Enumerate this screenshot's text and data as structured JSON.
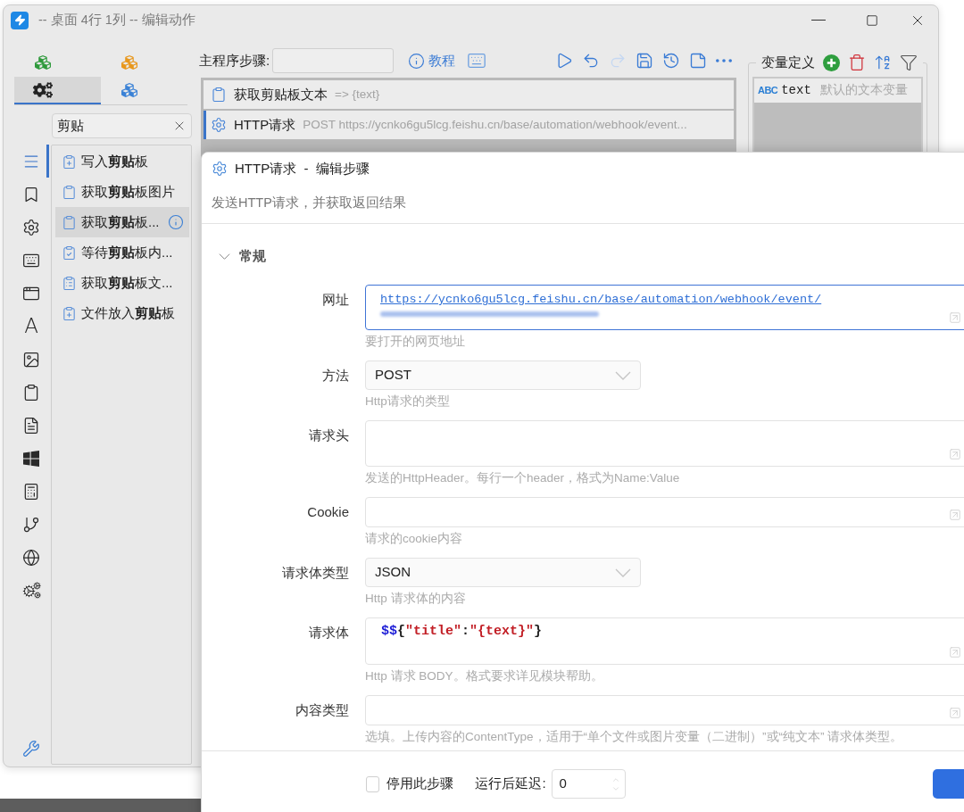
{
  "window": {
    "title": "-- 桌面 4行 1列 -- 编辑动作"
  },
  "palette_tabs": [
    {
      "kind": "cubes",
      "color": "#2f9a3c",
      "selected": false
    },
    {
      "kind": "cubes",
      "color": "#e8971c",
      "selected": false
    },
    {
      "kind": "gears",
      "selected": true
    },
    {
      "kind": "cubes",
      "color": "#3b82d6",
      "selected": false
    }
  ],
  "search": {
    "value": "剪贴"
  },
  "categories": [
    {
      "kind": "list",
      "selected": true
    },
    {
      "kind": "bookmark",
      "selected": false
    },
    {
      "kind": "gear",
      "selected": false
    },
    {
      "kind": "keyboard",
      "selected": false
    },
    {
      "kind": "window",
      "selected": false
    },
    {
      "kind": "glyph",
      "glyph": "A",
      "selected": false
    },
    {
      "kind": "image",
      "selected": false
    },
    {
      "kind": "clipboard",
      "selected": false
    },
    {
      "kind": "document",
      "selected": false
    },
    {
      "kind": "windows",
      "selected": false
    },
    {
      "kind": "calculator",
      "selected": false
    },
    {
      "kind": "branch",
      "selected": false
    },
    {
      "kind": "globe",
      "selected": false
    },
    {
      "kind": "gears",
      "selected": false
    }
  ],
  "actions": [
    {
      "kind": "plus",
      "label": "写入**剪贴**板",
      "selected": false
    },
    {
      "kind": "plain",
      "label": "获取**剪贴**板图片",
      "selected": false
    },
    {
      "kind": "plain",
      "label": "获取**剪贴**板...",
      "selected": true
    },
    {
      "kind": "check",
      "label": "等待**剪贴**板内...",
      "selected": false
    },
    {
      "kind": "list",
      "label": "获取**剪贴**板文...",
      "selected": false
    },
    {
      "kind": "plus",
      "label": "文件放入**剪贴**板",
      "selected": false
    }
  ],
  "main_steps": {
    "label": "主程序步骤:",
    "tutorial": "教程"
  },
  "toolbar": [
    {
      "kind": "play",
      "disabled": false
    },
    {
      "kind": "undo",
      "disabled": false
    },
    {
      "kind": "redo",
      "disabled": true
    },
    {
      "kind": "save",
      "disabled": false
    },
    {
      "kind": "history",
      "disabled": false
    },
    {
      "kind": "note",
      "disabled": false
    },
    {
      "kind": "more",
      "disabled": false
    }
  ],
  "steps": [
    {
      "kind": "clipboard",
      "name": "获取剪贴板文本",
      "detail": "=> {text}",
      "selected": false
    },
    {
      "kind": "gear",
      "name": "HTTP请求",
      "detail": "POST https://ycnko6gu5lcg.feishu.cn/base/automation/webhook/event...",
      "selected": true
    }
  ],
  "variables": {
    "title": "变量定义",
    "items": [
      {
        "type": "ABC",
        "name": "text",
        "description": "默认的文本变量"
      }
    ]
  },
  "dialog": {
    "title": "HTTP请求  -  编辑步骤",
    "description": "发送HTTP请求，并获取返回结果",
    "section": {
      "title": "常规",
      "expanded": true
    },
    "fields": [
      {
        "kind": "link",
        "label": "网址",
        "value": "https://ycnko6gu5lcg.feishu.cn/base/automation/webhook/event/",
        "hint": "要打开的网页地址",
        "focused": true
      },
      {
        "kind": "select",
        "label": "方法",
        "value": "POST",
        "hint": "Http请求的类型",
        "focused": false
      },
      {
        "kind": "textarea",
        "label": "请求头",
        "hint": "发送的HttpHeader。每行一个header，格式为Name:Value",
        "focused": false
      },
      {
        "kind": "text",
        "label": "Cookie",
        "hint": "请求的cookie内容",
        "focused": false
      },
      {
        "kind": "select",
        "label": "请求体类型",
        "value": "JSON",
        "hint": "Http 请求体的内容",
        "focused": false
      },
      {
        "kind": "code",
        "label": "请求体",
        "value": "$${\"title\":\"{text}\"}",
        "hint": "Http 请求 BODY。格式要求详见模块帮助。",
        "focused": false
      },
      {
        "kind": "text",
        "label": "内容类型",
        "hint": "选填。上传内容的ContentType，适用于“单个文件或图片变量（二进制）”或“纯文本” 请求体类型。",
        "focused": false
      }
    ],
    "footer": {
      "disable_label": "停用此步骤",
      "disable_checked": false,
      "delay_label": "运行后延迟:",
      "delay_value": "0"
    }
  }
}
